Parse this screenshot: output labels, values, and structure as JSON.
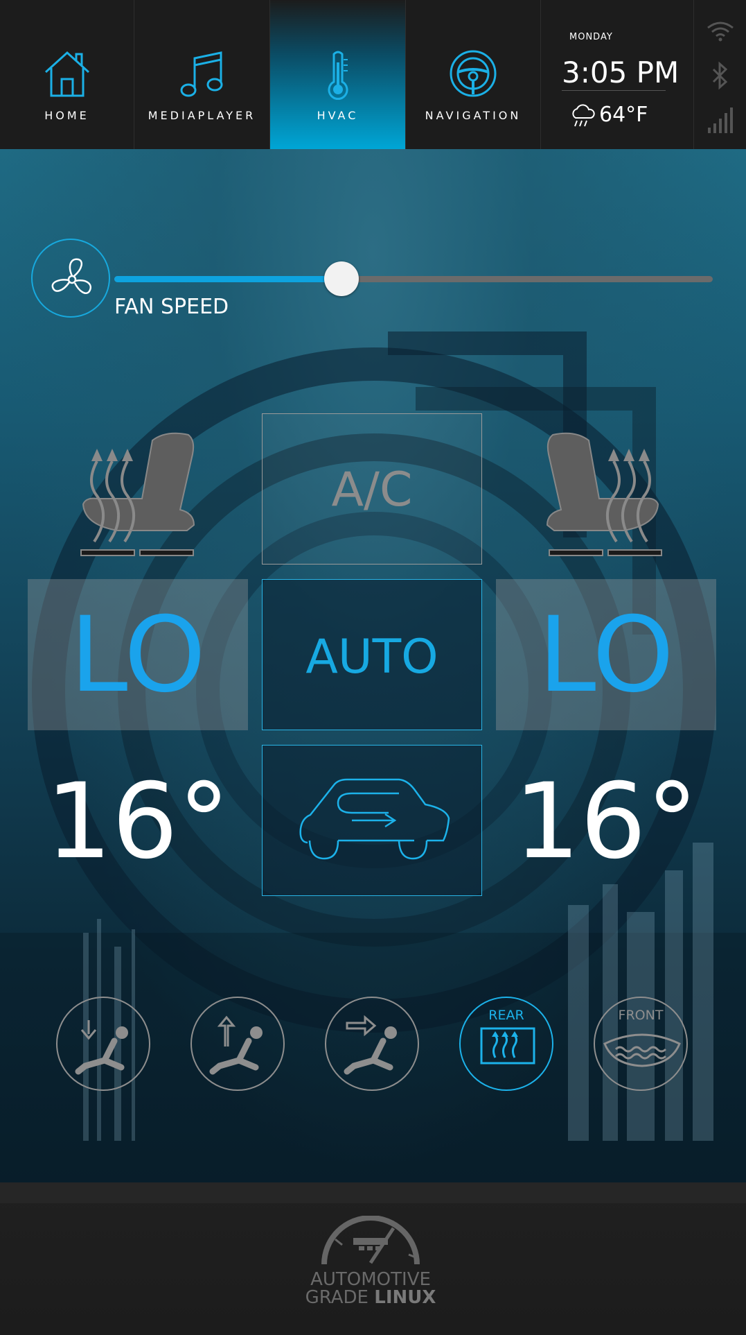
{
  "nav": {
    "tabs": [
      {
        "label": "HOME",
        "icon": "home-icon"
      },
      {
        "label": "MEDIAPLAYER",
        "icon": "music-note-icon"
      },
      {
        "label": "HVAC",
        "icon": "thermometer-icon",
        "active": true
      },
      {
        "label": "NAVIGATION",
        "icon": "steering-wheel-icon"
      }
    ]
  },
  "status": {
    "day": "MONDAY",
    "time": "3:05 PM",
    "weather_icon": "rain-cloud-icon",
    "temperature": "64°F",
    "icons": [
      "wifi-icon",
      "bluetooth-icon",
      "signal-bars-icon"
    ]
  },
  "hvac": {
    "fan_label": "FAN SPEED",
    "fan_speed_fraction": 0.38,
    "ac_label": "A/C",
    "auto_label": "AUTO",
    "left_fan": "LO",
    "right_fan": "LO",
    "left_temp": "16°",
    "right_temp": "16°",
    "left_seat_heat_level": 0,
    "right_seat_heat_level": 0,
    "vents": [
      {
        "icon": "airflow-feet-icon",
        "label": "",
        "active": false
      },
      {
        "icon": "airflow-head-icon",
        "label": "",
        "active": false
      },
      {
        "icon": "airflow-body-icon",
        "label": "",
        "active": false
      },
      {
        "icon": "rear-defrost-icon",
        "label": "REAR",
        "active": true
      },
      {
        "icon": "front-defrost-icon",
        "label": "FRONT",
        "active": false
      }
    ]
  },
  "footer": {
    "logo_line1": "AUTOMOTIVE",
    "logo_line2_a": "GRADE ",
    "logo_line2_b": "LINUX"
  },
  "colors": {
    "accent": "#17a9e2",
    "inactive": "#8e8e8e",
    "topbar": "#1c1c1c"
  }
}
